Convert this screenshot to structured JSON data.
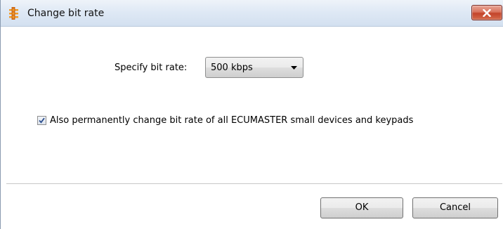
{
  "window": {
    "title": "Change bit rate",
    "app_icon": "ecumaster-icon",
    "close_icon": "close-icon"
  },
  "bit_rate": {
    "label": "Specify bit rate:",
    "selected": "500 kbps",
    "dropdown_icon": "chevron-down-icon"
  },
  "also_change": {
    "checked": true,
    "label": "Also permanently change bit rate of all ECUMASTER small devices and keypads"
  },
  "buttons": {
    "ok": "OK",
    "cancel": "Cancel"
  },
  "colors": {
    "close_button": "#c3442a",
    "icon_orange": "#e07b1a",
    "check_blue": "#2d4f8e"
  }
}
